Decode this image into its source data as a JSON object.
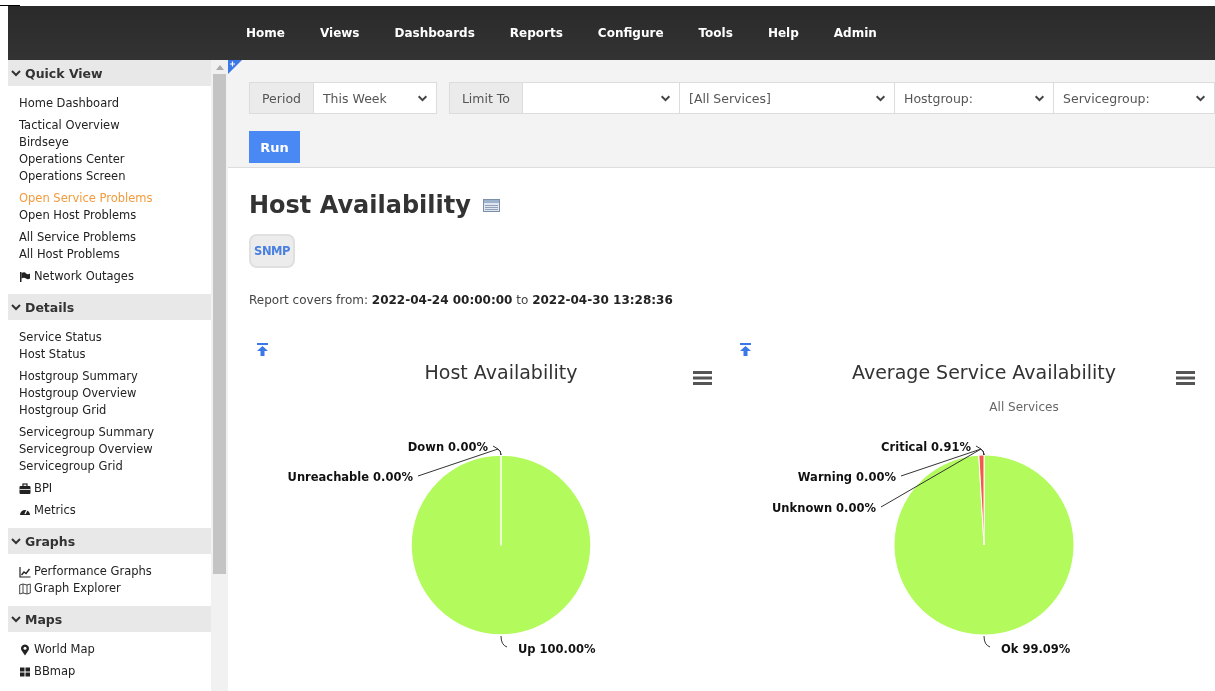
{
  "nav": [
    "Home",
    "Views",
    "Dashboards",
    "Reports",
    "Configure",
    "Tools",
    "Help",
    "Admin"
  ],
  "sidebar": {
    "sections": [
      {
        "title": "Quick View",
        "expanded": true,
        "groups": [
          [
            {
              "label": "Home Dashboard",
              "selected": false
            }
          ],
          [
            {
              "label": "Tactical Overview",
              "selected": false
            },
            {
              "label": "Birdseye",
              "selected": false
            },
            {
              "label": "Operations Center",
              "selected": false
            },
            {
              "label": "Operations Screen",
              "selected": false
            }
          ],
          [
            {
              "label": "Open Service Problems",
              "selected": true
            },
            {
              "label": "Open Host Problems",
              "selected": false
            }
          ],
          [
            {
              "label": "All Service Problems",
              "selected": false
            },
            {
              "label": "All Host Problems",
              "selected": false
            }
          ],
          [
            {
              "label": "Network Outages",
              "selected": false,
              "kind": "flag"
            }
          ]
        ]
      },
      {
        "title": "Details",
        "expanded": true,
        "groups": [
          [
            {
              "label": "Service Status",
              "selected": false
            },
            {
              "label": "Host Status",
              "selected": false
            }
          ],
          [
            {
              "label": "Hostgroup Summary",
              "selected": false
            },
            {
              "label": "Hostgroup Overview",
              "selected": false
            },
            {
              "label": "Hostgroup Grid",
              "selected": false
            }
          ],
          [
            {
              "label": "Servicegroup Summary",
              "selected": false
            },
            {
              "label": "Servicegroup Overview",
              "selected": false
            },
            {
              "label": "Servicegroup Grid",
              "selected": false
            }
          ],
          [
            {
              "label": "BPI",
              "selected": false,
              "kind": "briefcase"
            }
          ],
          [
            {
              "label": "Metrics",
              "selected": false,
              "kind": "gauge"
            }
          ]
        ]
      },
      {
        "title": "Graphs",
        "expanded": true,
        "groups": [
          [
            {
              "label": "Performance Graphs",
              "selected": false,
              "kind": "linechart"
            },
            {
              "label": "Graph Explorer",
              "selected": false,
              "kind": "map"
            }
          ]
        ]
      },
      {
        "title": "Maps",
        "expanded": true,
        "groups": [
          [
            {
              "label": "World Map",
              "selected": false,
              "kind": "pin"
            }
          ],
          [
            {
              "label": "BBmap",
              "selected": false,
              "kind": "grid"
            }
          ]
        ]
      }
    ]
  },
  "filters": {
    "period": {
      "label": "Period",
      "value": "This Week"
    },
    "limit_to": {
      "label": "Limit To"
    },
    "service": {
      "value": "[All Services]"
    },
    "hostgroup": {
      "placeholder": "Hostgroup:"
    },
    "servicegroup": {
      "placeholder": "Servicegroup:"
    }
  },
  "run_button": "Run",
  "page_title": "Host Availability",
  "badge": "SNMP",
  "report_range": "Report covers from: **2022-04-24 00:00:00** to **2022-04-30 13:28:36**",
  "charts": [
    {
      "chart_data": {
        "type": "pie",
        "title": "Host Availability",
        "categories": [
          "Up",
          "Down",
          "Unreachable"
        ],
        "values": [
          100,
          0,
          0
        ],
        "colors": [
          "#b3fb5c",
          null,
          null
        ],
        "data_labels": true,
        "value_labels": [
          "100.00%",
          "0.00%",
          "0.00%"
        ]
      }
    },
    {
      "subtitle": "All Services",
      "chart_data": {
        "type": "pie",
        "title": "Average Service Availability",
        "categories": [
          "Ok",
          "Critical",
          "Warning",
          "Unknown"
        ],
        "values": [
          99.09,
          0.91,
          0,
          0
        ],
        "colors": [
          "#b3fb5c",
          "#f4584a",
          null,
          null
        ],
        "data_labels": true,
        "value_labels": [
          "99.09%",
          "0.91%",
          "0.00%",
          "0.00%"
        ]
      }
    }
  ]
}
